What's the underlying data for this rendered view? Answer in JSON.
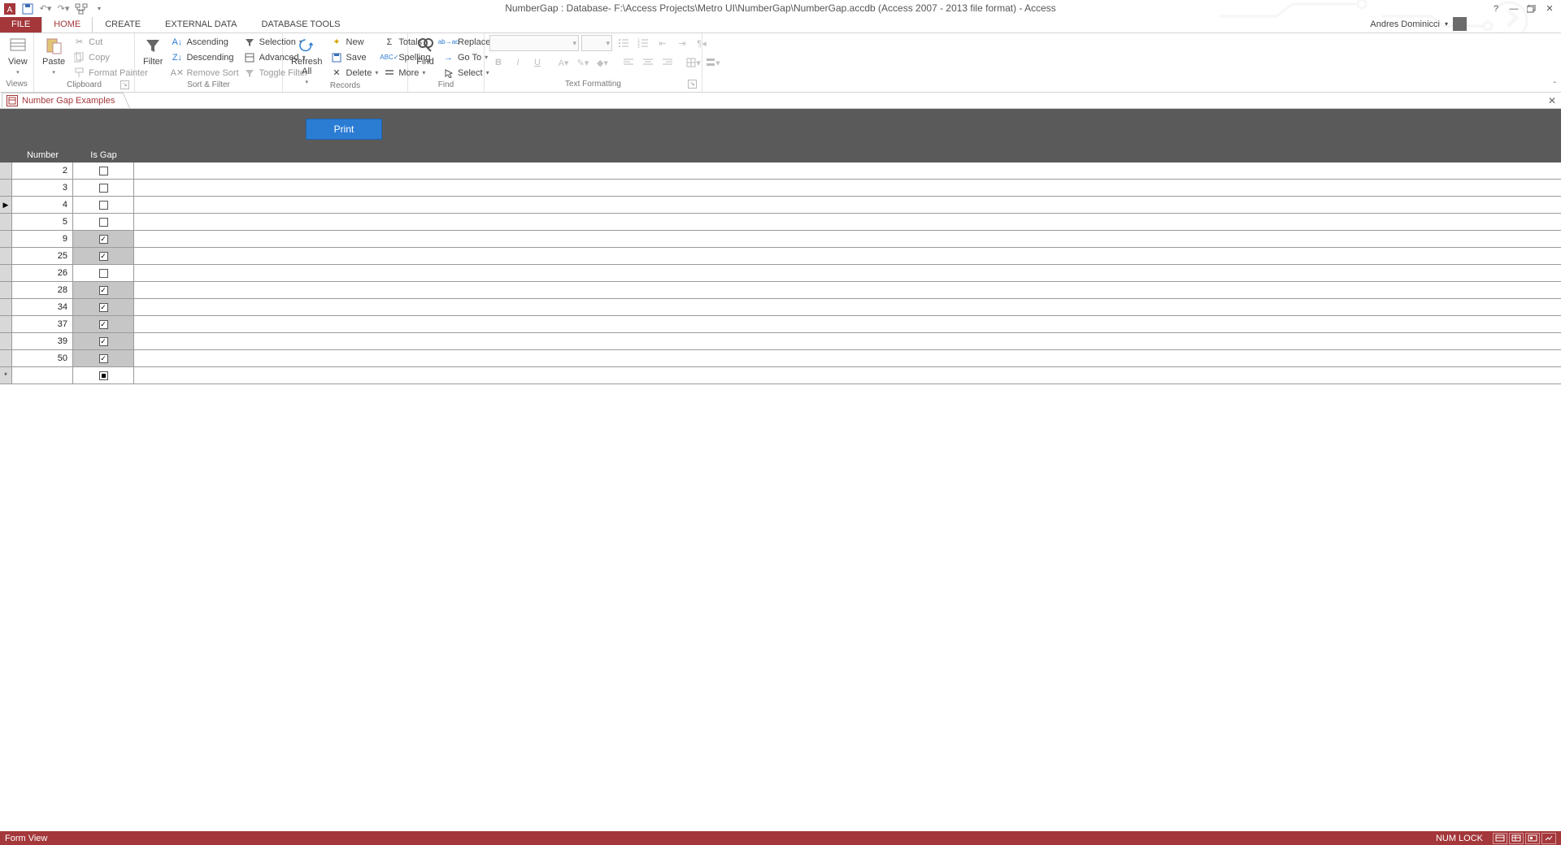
{
  "title": "NumberGap : Database- F:\\Access Projects\\Metro UI\\NumberGap\\NumberGap.accdb (Access 2007 - 2013 file format) - Access",
  "user": "Andres Dominicci",
  "tabs": {
    "file": "FILE",
    "home": "HOME",
    "create": "CREATE",
    "external": "EXTERNAL DATA",
    "dbtools": "DATABASE TOOLS"
  },
  "groups": {
    "views": {
      "label": "Views",
      "view": "View"
    },
    "clipboard": {
      "label": "Clipboard",
      "paste": "Paste",
      "cut": "Cut",
      "copy": "Copy",
      "fmt": "Format Painter"
    },
    "sort": {
      "label": "Sort & Filter",
      "filter": "Filter",
      "asc": "Ascending",
      "desc": "Descending",
      "remove": "Remove Sort",
      "selection": "Selection",
      "advanced": "Advanced",
      "toggle": "Toggle Filter"
    },
    "records": {
      "label": "Records",
      "refresh": "Refresh\nAll",
      "new": "New",
      "save": "Save",
      "delete": "Delete",
      "totals": "Totals",
      "spelling": "Spelling",
      "more": "More"
    },
    "find": {
      "label": "Find",
      "find": "Find",
      "replace": "Replace",
      "goto": "Go To",
      "select": "Select"
    },
    "text": {
      "label": "Text Formatting"
    }
  },
  "doctab": "Number Gap Examples",
  "print": "Print",
  "columns": {
    "number": "Number",
    "isgap": "Is Gap"
  },
  "rows": [
    {
      "n": 2,
      "gap": false
    },
    {
      "n": 3,
      "gap": false
    },
    {
      "n": 4,
      "gap": false,
      "current": true
    },
    {
      "n": 5,
      "gap": false
    },
    {
      "n": 9,
      "gap": true
    },
    {
      "n": 25,
      "gap": true
    },
    {
      "n": 26,
      "gap": false
    },
    {
      "n": 28,
      "gap": true
    },
    {
      "n": 34,
      "gap": true
    },
    {
      "n": 37,
      "gap": true
    },
    {
      "n": 39,
      "gap": true
    },
    {
      "n": 50,
      "gap": true
    }
  ],
  "status": {
    "left": "Form View",
    "numlock": "NUM LOCK"
  }
}
